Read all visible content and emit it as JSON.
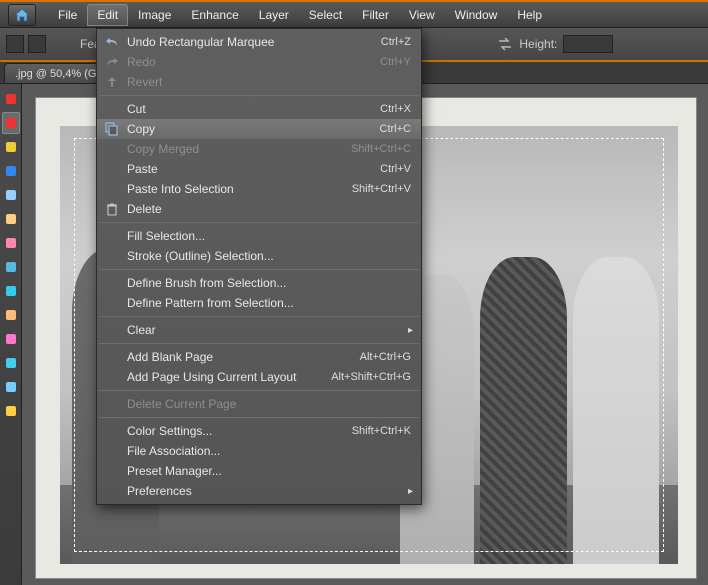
{
  "menubar": {
    "items": [
      "File",
      "Edit",
      "Image",
      "Enhance",
      "Layer",
      "Select",
      "Filter",
      "View",
      "Window",
      "Help"
    ],
    "open_index": 1
  },
  "toolbar": {
    "feather_label": "Feather",
    "height_label": "Height:"
  },
  "document": {
    "tab_label": ".jpg @ 50,4% (G"
  },
  "tool_strip": {
    "tools": [
      "move",
      "marquee",
      "lasso",
      "wand",
      "crop",
      "eyedropper",
      "heal",
      "brush",
      "clone",
      "eraser",
      "fill",
      "gradient",
      "blur",
      "sponge"
    ]
  },
  "edit_menu": [
    {
      "label": "Undo Rectangular Marquee",
      "shortcut": "Ctrl+Z",
      "icon": "undo-icon"
    },
    {
      "label": "Redo",
      "shortcut": "Ctrl+Y",
      "icon": "redo-icon",
      "disabled": true
    },
    {
      "label": "Revert",
      "shortcut": "",
      "icon": "revert-icon",
      "disabled": true
    },
    {
      "sep": true
    },
    {
      "label": "Cut",
      "shortcut": "Ctrl+X"
    },
    {
      "label": "Copy",
      "shortcut": "Ctrl+C",
      "icon": "copy-icon",
      "highlight": true
    },
    {
      "label": "Copy Merged",
      "shortcut": "Shift+Ctrl+C",
      "disabled": true
    },
    {
      "label": "Paste",
      "shortcut": "Ctrl+V"
    },
    {
      "label": "Paste Into Selection",
      "shortcut": "Shift+Ctrl+V"
    },
    {
      "label": "Delete",
      "shortcut": "",
      "icon": "trash-icon"
    },
    {
      "sep": true
    },
    {
      "label": "Fill Selection...",
      "shortcut": ""
    },
    {
      "label": "Stroke (Outline) Selection...",
      "shortcut": ""
    },
    {
      "sep": true
    },
    {
      "label": "Define Brush from Selection...",
      "shortcut": ""
    },
    {
      "label": "Define Pattern from Selection...",
      "shortcut": ""
    },
    {
      "sep": true
    },
    {
      "label": "Clear",
      "shortcut": "",
      "submenu": true
    },
    {
      "sep": true
    },
    {
      "label": "Add Blank Page",
      "shortcut": "Alt+Ctrl+G"
    },
    {
      "label": "Add Page Using Current Layout",
      "shortcut": "Alt+Shift+Ctrl+G"
    },
    {
      "sep": true
    },
    {
      "label": "Delete Current Page",
      "shortcut": "",
      "disabled": true
    },
    {
      "sep": true
    },
    {
      "label": "Color Settings...",
      "shortcut": "Shift+Ctrl+K"
    },
    {
      "label": "File Association...",
      "shortcut": ""
    },
    {
      "label": "Preset Manager...",
      "shortcut": ""
    },
    {
      "label": "Preferences",
      "shortcut": "",
      "submenu": true
    }
  ]
}
